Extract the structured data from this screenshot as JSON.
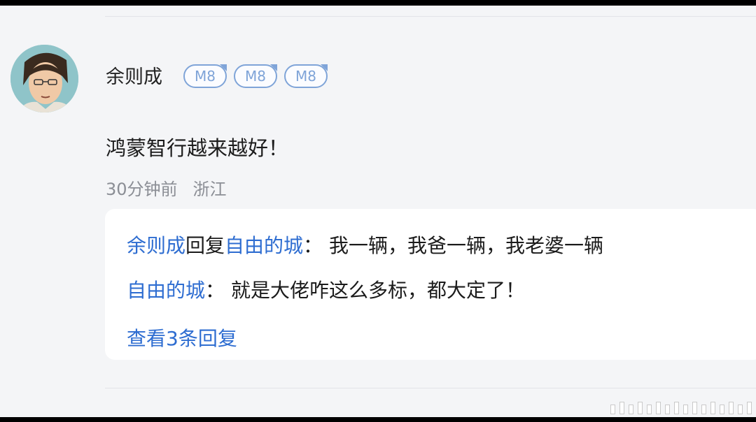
{
  "comment": {
    "username": "余则成",
    "badges": [
      "M8",
      "M8",
      "M8"
    ],
    "text": "鸿蒙智行越来越好！",
    "time": "30分钟前",
    "location": "浙江"
  },
  "replies": [
    {
      "author": "余则成",
      "verb": "回复",
      "target": "自由的城",
      "separator": "：",
      "text": "我一辆，我爸一辆，我老婆一辆"
    },
    {
      "author": "自由的城",
      "separator": "：",
      "text": "就是大佬咋这么多标，都大定了！"
    }
  ],
  "view_more_label": "查看3条回复",
  "colors": {
    "link": "#2e6dd1",
    "badge": "#7fa4d8",
    "background": "#f4f5f7"
  },
  "icons": {
    "avatar": "anime-man-avatar",
    "watermark": "bar-pattern-watermark"
  }
}
